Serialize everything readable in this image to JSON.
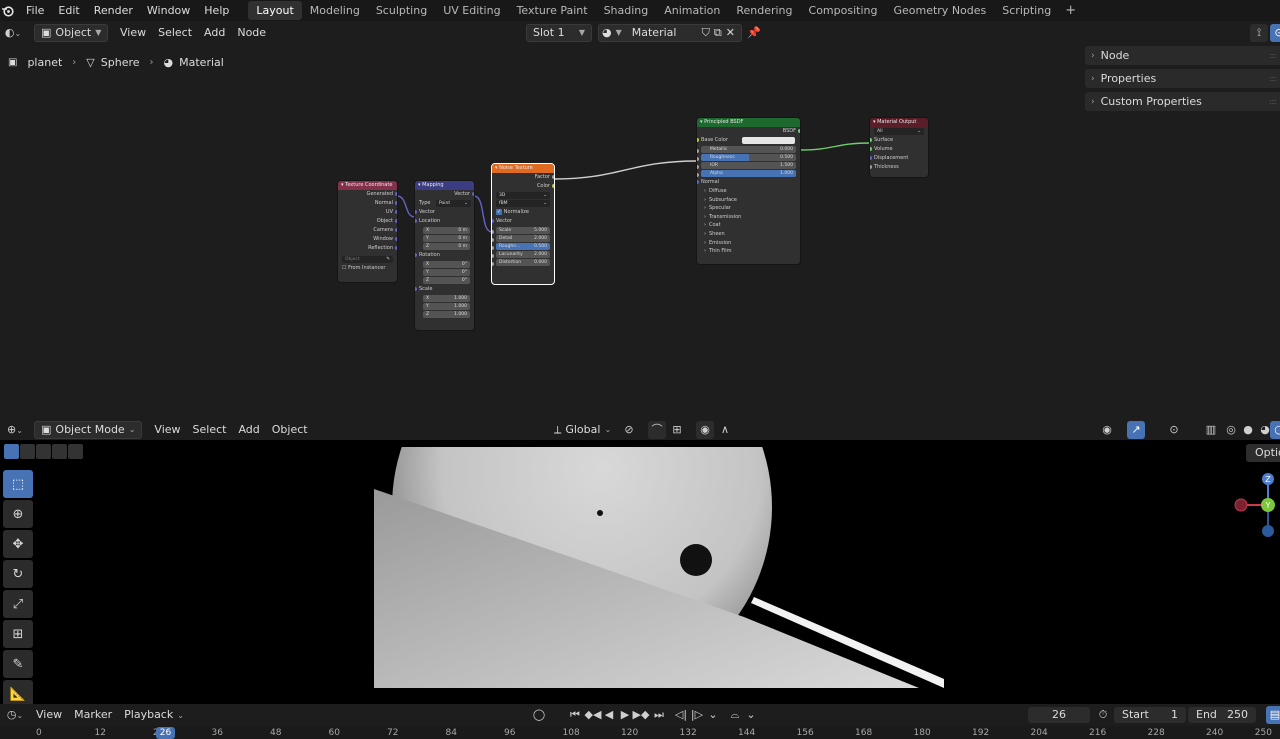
{
  "menu": [
    "File",
    "Edit",
    "Render",
    "Window",
    "Help"
  ],
  "workspaces": [
    "Layout",
    "Modeling",
    "Sculpting",
    "UV Editing",
    "Texture Paint",
    "Shading",
    "Animation",
    "Rendering",
    "Compositing",
    "Geometry Nodes",
    "Scripting"
  ],
  "active_workspace": "Layout",
  "node_header": {
    "object_dropdown": "Object",
    "menus": [
      "View",
      "Select",
      "Add",
      "Node"
    ],
    "slot": "Slot 1",
    "material": "Material"
  },
  "breadcrumb": [
    "planet",
    "Sphere",
    "Material"
  ],
  "side_panels": [
    "Node",
    "Properties",
    "Custom Properties"
  ],
  "nodes": {
    "texcoord": {
      "title": "Texture Coordinate",
      "outputs": [
        "Generated",
        "Normal",
        "UV",
        "Object",
        "Camera",
        "Window",
        "Reflection"
      ],
      "object_placeholder": "Object",
      "from_instancer": "From Instancer"
    },
    "mapping": {
      "title": "Mapping",
      "output": "Vector",
      "type_label": "Type",
      "type_value": "Point",
      "vector": "Vector",
      "location": "Location",
      "loc": [
        [
          "X",
          "0 m"
        ],
        [
          "Y",
          "0 m"
        ],
        [
          "Z",
          "0 m"
        ]
      ],
      "rotation": "Rotation",
      "rot": [
        [
          "X",
          "0°"
        ],
        [
          "Y",
          "0°"
        ],
        [
          "Z",
          "0°"
        ]
      ],
      "scale": "Scale",
      "scl": [
        [
          "X",
          "1.000"
        ],
        [
          "Y",
          "1.000"
        ],
        [
          "Z",
          "1.000"
        ]
      ]
    },
    "noise": {
      "title": "Noise Texture",
      "outputs": [
        "Factor",
        "Color"
      ],
      "dim": "3D",
      "type": "fBM",
      "normalize": "Normalize",
      "vector": "Vector",
      "fields": [
        [
          "Scale",
          "5.000"
        ],
        [
          "Detail",
          "2.000"
        ],
        [
          "Roughn...",
          "0.500"
        ],
        [
          "Lacunarity",
          "2.000"
        ],
        [
          "Distortion",
          "0.000"
        ]
      ]
    },
    "bsdf": {
      "title": "Principled BSDF",
      "output": "BSDF",
      "base_color": "Base Color",
      "fields": [
        [
          "Metallic",
          "0.000"
        ],
        [
          "Roughness",
          "0.500"
        ],
        [
          "IOR",
          "1.500"
        ],
        [
          "Alpha",
          "1.000"
        ]
      ],
      "normal": "Normal",
      "panels": [
        "Diffuse",
        "Subsurface",
        "Specular",
        "Transmission",
        "Coat",
        "Sheen",
        "Emission",
        "Thin Film"
      ]
    },
    "output": {
      "title": "Material Output",
      "target": "All",
      "inputs": [
        "Surface",
        "Volume",
        "Displacement",
        "Thickness"
      ]
    }
  },
  "viewport_header": {
    "mode": "Object Mode",
    "menus": [
      "View",
      "Select",
      "Add",
      "Object"
    ],
    "orientation": "Global"
  },
  "viewport_options": "Options",
  "axis_labels": {
    "z": "Z",
    "y": "Y"
  },
  "timeline": {
    "menus": [
      "View",
      "Marker",
      "Playback"
    ],
    "current_frame": "26",
    "start_label": "Start",
    "start": "1",
    "end_label": "End",
    "end": "250",
    "ticks": [
      "0",
      "12",
      "24",
      "36",
      "48",
      "60",
      "72",
      "84",
      "96",
      "108",
      "120",
      "132",
      "144",
      "156",
      "168",
      "180",
      "192",
      "204",
      "216",
      "228",
      "240",
      "250"
    ]
  },
  "colors": {
    "accent": "#4772b3",
    "texcoord_header": "#83314a",
    "vector_header": "#3c3c83",
    "texture_header": "#e06a1f",
    "shader_header": "#1e6a2e",
    "output_header": "#5a1e29"
  }
}
